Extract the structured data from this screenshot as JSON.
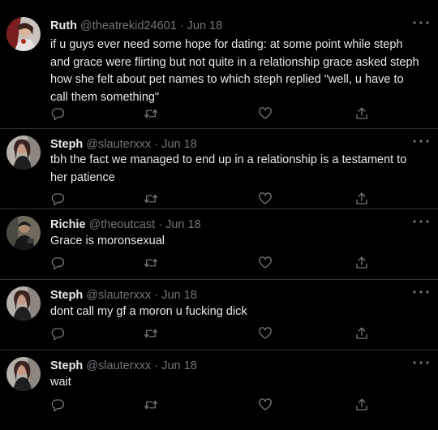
{
  "tweets": [
    {
      "name": "Ruth",
      "handle": "@theatrekid24601",
      "separator": "·",
      "date": "Jun 18",
      "text": "if u guys ever need some hope for dating: at some point while steph and grace were flirting but not quite in a relationship grace asked steph how she felt about pet names to which steph replied \"well, u have to call them something\""
    },
    {
      "name": "Steph",
      "handle": "@slauterxxx",
      "separator": "·",
      "date": "Jun 18",
      "text": "tbh the fact we managed to end up in a relationship is a testament to her patience"
    },
    {
      "name": "Richie",
      "handle": "@theoutcast",
      "separator": "·",
      "date": "Jun 18",
      "text": "Grace is moronsexual"
    },
    {
      "name": "Steph",
      "handle": "@slauterxxx",
      "separator": "·",
      "date": "Jun 18",
      "text": "dont call my gf a moron u fucking dick"
    },
    {
      "name": "Steph",
      "handle": "@slauterxxx",
      "separator": "·",
      "date": "Jun 18",
      "text": "wait"
    }
  ],
  "icons": {
    "reply": "reply-icon",
    "retweet": "retweet-icon",
    "like": "like-icon",
    "share": "share-icon",
    "more": "more-icon"
  },
  "colors": {
    "background": "#000000",
    "text": "#e7e9ea",
    "secondary": "#71767b",
    "divider": "#2f3336"
  }
}
